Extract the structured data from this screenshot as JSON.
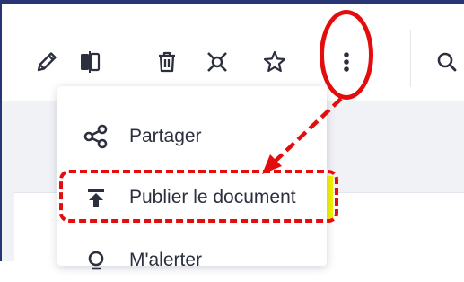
{
  "toolbar": {
    "buttons": [
      {
        "name": "edit",
        "icon": "pencil-icon"
      },
      {
        "name": "compare",
        "icon": "compare-icon"
      },
      {
        "name": "delete",
        "icon": "trash-icon"
      },
      {
        "name": "relations",
        "icon": "network-icon"
      },
      {
        "name": "favorite",
        "icon": "star-icon"
      },
      {
        "name": "more",
        "icon": "more-vertical-icon"
      },
      {
        "name": "search",
        "icon": "search-icon"
      }
    ]
  },
  "menu": {
    "items": [
      {
        "label": "Partager",
        "icon": "share-icon"
      },
      {
        "label": "Publier le document",
        "icon": "publish-upload-icon"
      },
      {
        "label": "M'alerter",
        "icon": "bell-icon"
      }
    ]
  },
  "colors": {
    "annotation_red": "#e40d0d",
    "highlight_yellow": "#f4f100",
    "header_navy": "#283474",
    "icon_dark": "#2b2f3e"
  }
}
